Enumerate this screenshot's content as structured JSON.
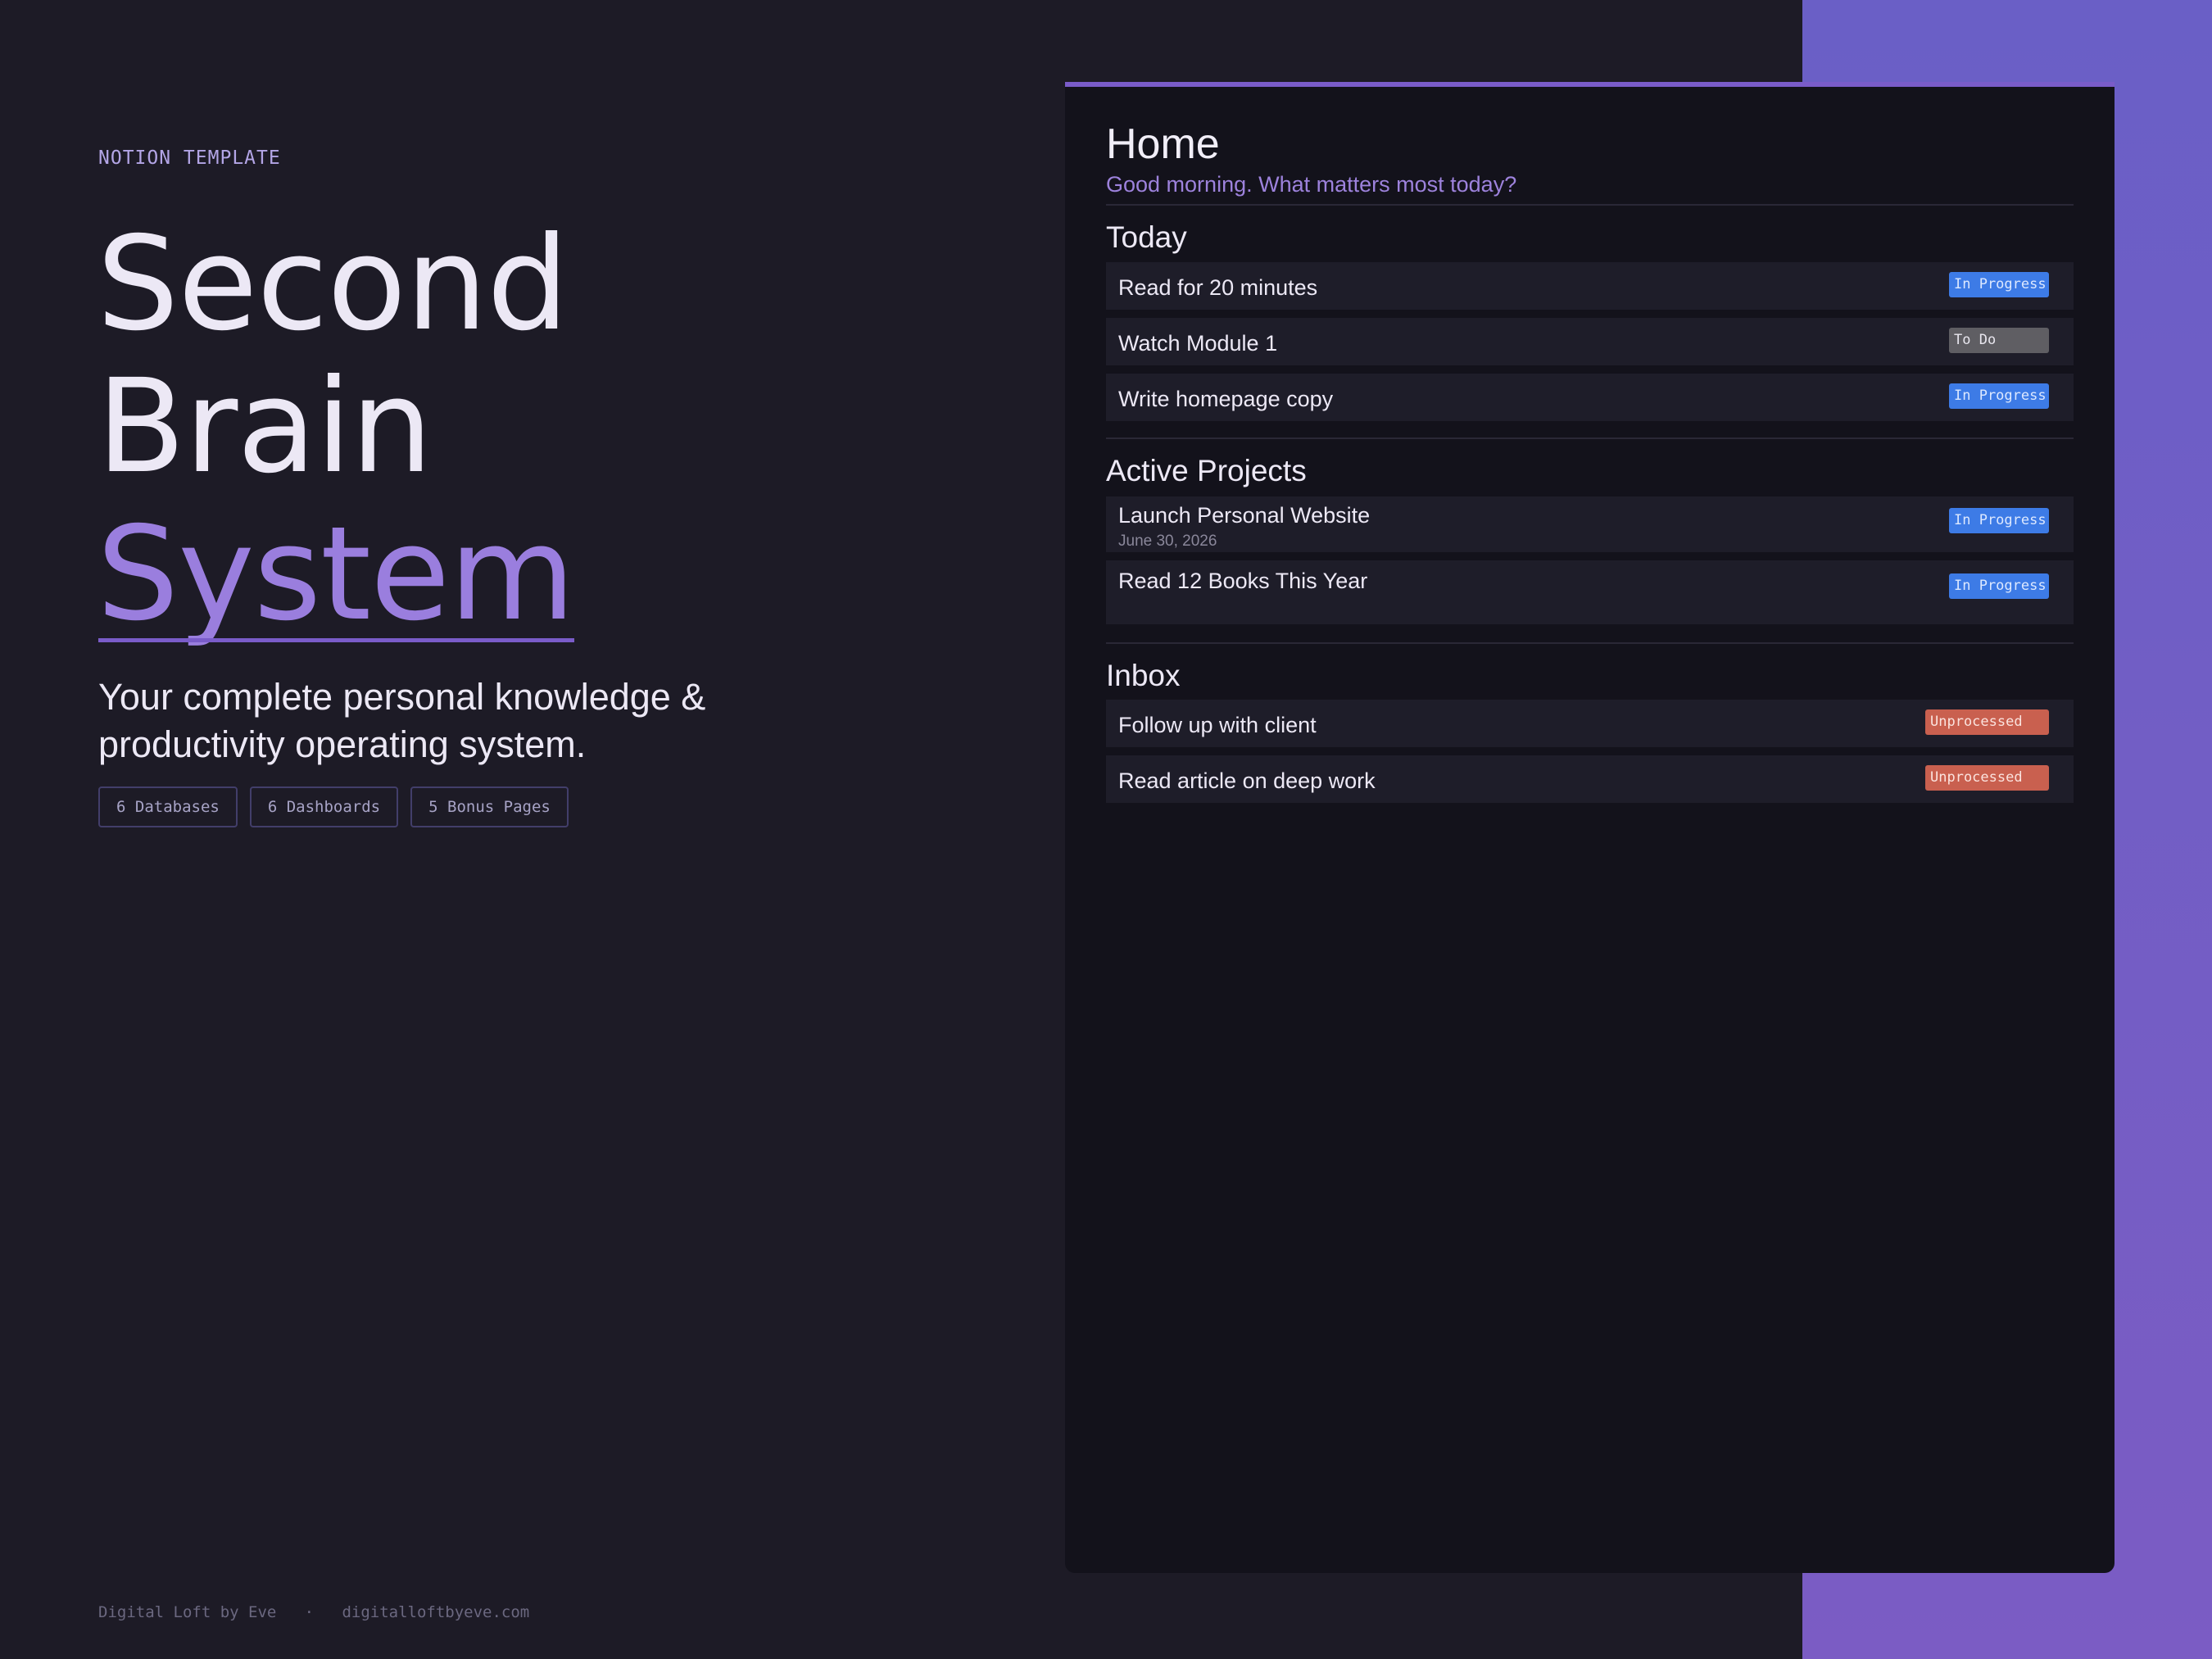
{
  "hero": {
    "eyebrow": "NOTION TEMPLATE",
    "line1": "Second",
    "line2": "Brain",
    "line3": "System",
    "subtitle": "Your complete personal knowledge & productivity operating system.",
    "chips": [
      "6 Databases",
      "6 Dashboards",
      "5 Bonus Pages"
    ]
  },
  "footer": {
    "brand": "Digital Loft by Eve",
    "separator": "·",
    "url": "digitalloftbyeve.com"
  },
  "page": {
    "title": "Home",
    "greeting": "Good morning. What matters most today?"
  },
  "today": {
    "title": "Today",
    "items": [
      {
        "label": "Read for 20 minutes",
        "status": "In Progress"
      },
      {
        "label": "Watch Module 1",
        "status": "To Do"
      },
      {
        "label": "Write homepage copy",
        "status": "In Progress"
      }
    ]
  },
  "projects": {
    "title": "Active Projects",
    "items": [
      {
        "label": "Launch Personal Website",
        "date": "June 30, 2026",
        "status": "In Progress"
      },
      {
        "label": "Read 12 Books This Year",
        "status": "In Progress"
      }
    ]
  },
  "inbox": {
    "title": "Inbox",
    "items": [
      {
        "label": "Follow up with client",
        "status": "Unprocessed"
      },
      {
        "label": "Read article on deep work",
        "status": "Unprocessed"
      }
    ]
  },
  "colors": {
    "background": "#1d1b26",
    "accent": "#7a5cc9",
    "in_progress": "#3d7be6",
    "to_do": "#5f5e63",
    "unprocessed": "#c9604f"
  }
}
